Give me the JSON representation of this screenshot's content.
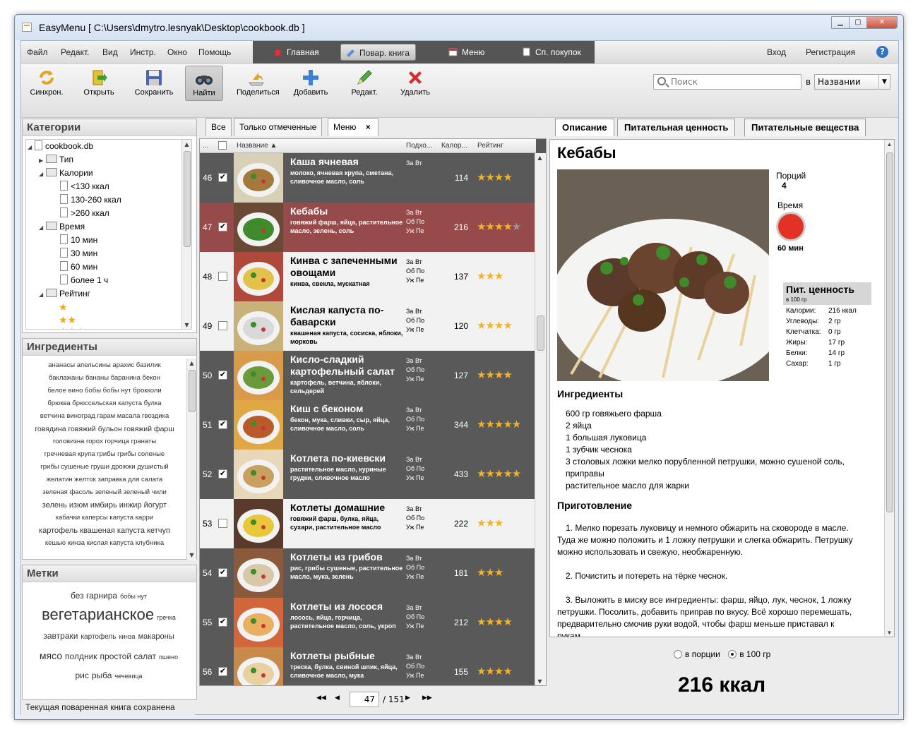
{
  "window": {
    "title": "EasyMenu [ C:\\Users\\dmytro.lesnyak\\Desktop\\cookbook.db ]",
    "buttons": {
      "minimize": "▁",
      "maximize": "▢",
      "close": "✕"
    }
  },
  "menu": [
    "Файл",
    "Редакт.",
    "Вид",
    "Инстр.",
    "Окно",
    "Помощь"
  ],
  "nav": {
    "home": "Главная",
    "cookbook": "Повар. книга",
    "menu": "Меню",
    "shopping": "Сп. покупок"
  },
  "auth": {
    "login": "Вход",
    "register": "Регистрация",
    "help": "?"
  },
  "toolbar": {
    "sync": "Синхрон.",
    "open": "Открыть",
    "save": "Сохранить",
    "find": "Найти",
    "share": "Поделиться",
    "add": "Добавить",
    "edit": "Редакт.",
    "delete": "Удалить"
  },
  "search": {
    "placeholder": "Поиск",
    "in_label": "в",
    "field": "Названии"
  },
  "categories": {
    "title": "Категории",
    "root": "cookbook.db",
    "type": "Тип",
    "calories": "Калории",
    "cal_items": [
      "<130 ккал",
      "130-260 ккал",
      ">260 ккал"
    ],
    "time": "Время",
    "time_items": [
      "10 мин",
      "30 мин",
      "60 мин",
      "более 1 ч"
    ],
    "rating": "Рейтинг"
  },
  "ingredients_panel": {
    "title": "Ингредиенты",
    "lines": [
      "ананасы апельсины арахис базилик",
      "баклажаны бананы баранина бекон",
      "белое вино бобы бобы нут брокколи",
      "брюква брюссельская капуста булка",
      "ветчина виноград гарам масала гвоздика",
      "говядина говяжий бульон говяжий фарш",
      "головизна горох горчица гранаты",
      "гречневая крупа грибы грибы соленые",
      "грибы сушеные груши дрожжи душистый",
      "желатин желток заправка для салата",
      "зеленая фасоль зеленый зеленый чили",
      "зелень изюм имбирь инжир йогурт",
      "кабачки каперсы капуста карри",
      "картофель квашеная капуста кетчуп",
      "кешью кинза кислая капуста клубника"
    ]
  },
  "tags": {
    "title": "Метки",
    "lines": [
      [
        "без гарнира",
        "бобы нут"
      ],
      [
        "вегетарианское",
        "гречка"
      ],
      [
        "завтраки",
        "картофель",
        "кинза",
        "макароны"
      ],
      [
        "мясо",
        "полдник",
        "простой салат",
        "пшено"
      ],
      [
        "рис",
        "рыба",
        "чечевица"
      ]
    ]
  },
  "status": "Текущая поваренная книга сохранена",
  "list_tabs": {
    "all": "Все",
    "marked": "Только отмеченные",
    "menu": "Меню",
    "close": "×"
  },
  "grid": {
    "headers": {
      "more": "...",
      "name": "Название",
      "serve": "Подхо...",
      "cal": "Калор...",
      "rating": "Рейтинг"
    },
    "rows": [
      {
        "num": "46",
        "checked": "✔",
        "name": "Каша ячневая",
        "ingr": "молоко, ячневая крупа, сметана, сливочное масло, соль",
        "sub": [
          "За Вт"
        ],
        "kcal": "114",
        "stars": 4,
        "style": "dark"
      },
      {
        "num": "47",
        "checked": "✔",
        "name": "Кебабы",
        "ingr": "говяжий фарш, яйца, растительное масло, зелень, соль",
        "sub": [
          "За Вт",
          "Об По",
          "Уж Пе"
        ],
        "kcal": "216",
        "stars": 4,
        "style": "selr"
      },
      {
        "num": "48",
        "checked": "",
        "name": "Кинва с запеченными овощами",
        "ingr": "кинва, свекла, мускатная",
        "sub": [
          "За Вт",
          "Об По",
          "Уж Пе"
        ],
        "kcal": "137",
        "stars": 3,
        "style": "light"
      },
      {
        "num": "49",
        "checked": "",
        "name": "Кислая капуста по-баварски",
        "ingr": "квашеная капуста, сосиска, яблоки, морковь",
        "sub": [
          "За Вт",
          "Об По",
          "Уж Пе"
        ],
        "kcal": "120",
        "stars": 4,
        "style": "light"
      },
      {
        "num": "50",
        "checked": "✔",
        "name": "Кисло-сладкий картофельный салат",
        "ingr": "картофель, ветчина, яблоки, сельдерей",
        "sub": [
          "За Вт",
          "Об По",
          "Уж Пе"
        ],
        "kcal": "127",
        "stars": 4,
        "style": "dark"
      },
      {
        "num": "51",
        "checked": "✔",
        "name": "Киш с беконом",
        "ingr": "бекон, мука, сливки, сыр, яйца, сливочное масло, соль",
        "sub": [
          "За Вт",
          "Об По",
          "Уж Пе"
        ],
        "kcal": "344",
        "stars": 5,
        "style": "dark"
      },
      {
        "num": "52",
        "checked": "✔",
        "name": "Котлета по-киевски",
        "ingr": "растительное масло, куриные грудки, сливочное масло",
        "sub": [
          "За Вт",
          "Об По",
          "Уж Пе"
        ],
        "kcal": "433",
        "stars": 5,
        "style": "dark"
      },
      {
        "num": "53",
        "checked": "",
        "name": "Котлеты домашние",
        "ingr": "говяжий фарш, булка, яйца, сухари, растительное масло",
        "sub": [
          "За Вт",
          "Об По",
          "Уж Пе"
        ],
        "kcal": "222",
        "stars": 3,
        "style": "light"
      },
      {
        "num": "54",
        "checked": "✔",
        "name": "Котлеты из грибов",
        "ingr": "рис, грибы сушеные, растительное масло, мука, зелень",
        "sub": [
          "За Вт",
          "Об По",
          "Уж Пе"
        ],
        "kcal": "181",
        "stars": 3,
        "style": "dark"
      },
      {
        "num": "55",
        "checked": "✔",
        "name": "Котлеты из лосося",
        "ingr": "лосось, яйца, горчица, растительное масло, соль, укроп",
        "sub": [
          "За Вт",
          "Об По",
          "Уж Пе"
        ],
        "kcal": "212",
        "stars": 4,
        "style": "dark"
      },
      {
        "num": "56",
        "checked": "✔",
        "name": "Котлеты рыбные",
        "ingr": "треска, булка, свиной шпик, яйца, сливочное масло, мука",
        "sub": [
          "За Вт",
          "Об По",
          "Уж Пе"
        ],
        "kcal": "155",
        "stars": 4,
        "style": "dark"
      }
    ]
  },
  "pager": {
    "current": "47",
    "total": "/ 151",
    "first": "◀◀",
    "prev": "◀",
    "next": "▶",
    "last": "▶▶"
  },
  "detail_tabs": {
    "desc": "Описание",
    "nutval": "Питательная ценность",
    "nutrients": "Питательные вещества"
  },
  "recipe": {
    "title": "Кебабы",
    "portions_label": "Порций",
    "portions": "4",
    "time_label": "Время",
    "time": "60 мин",
    "nut_title": "Пит. ценность",
    "nut_sub": "в 100 гр",
    "nutrition": [
      {
        "label": "Калории:",
        "value": "216 ккал"
      },
      {
        "label": "Углеводы:",
        "value": "2 гр"
      },
      {
        "label": "Клетчатка:",
        "value": "0 гр"
      },
      {
        "label": "Жиры:",
        "value": "17 гр"
      },
      {
        "label": "Белки:",
        "value": "14 гр"
      },
      {
        "label": "Сахар:",
        "value": "1 гр"
      }
    ],
    "ing_title": "Ингредиенты",
    "ingredients": [
      "600 гр говяжьего фарша",
      "2 яйца",
      "1 большая луковица",
      "1 зубчик чеснока",
      "3 столовых ложки мелко порубленной петрушки, можно сушеной соль, приправы",
      "растительное масло для жарки"
    ],
    "prep_title": "Приготовление",
    "steps": [
      "1. Мелко порезать луковицу и немного обжарить на сковороде в масле. Туда же можно положить и 1 ложку петрушки и слегка обжарить. Петрушку можно использовать и свежую, необжаренную.",
      "2. Почистить и потереть на тёрке чеснок.",
      "3. Выложить в миску все ингредиенты: фарш, яйцо, лук, чеснок, 1 ложку петрушки. Посолить, добавить приправ по вкусу. Всё хорошо перемешать, предварительно смочив руки водой, чтобы фарш меньше приставал к рукам."
    ]
  },
  "units": {
    "per_portion": "в порции",
    "per_100": "в 100 гр"
  },
  "big_kcal": "216 ккал"
}
